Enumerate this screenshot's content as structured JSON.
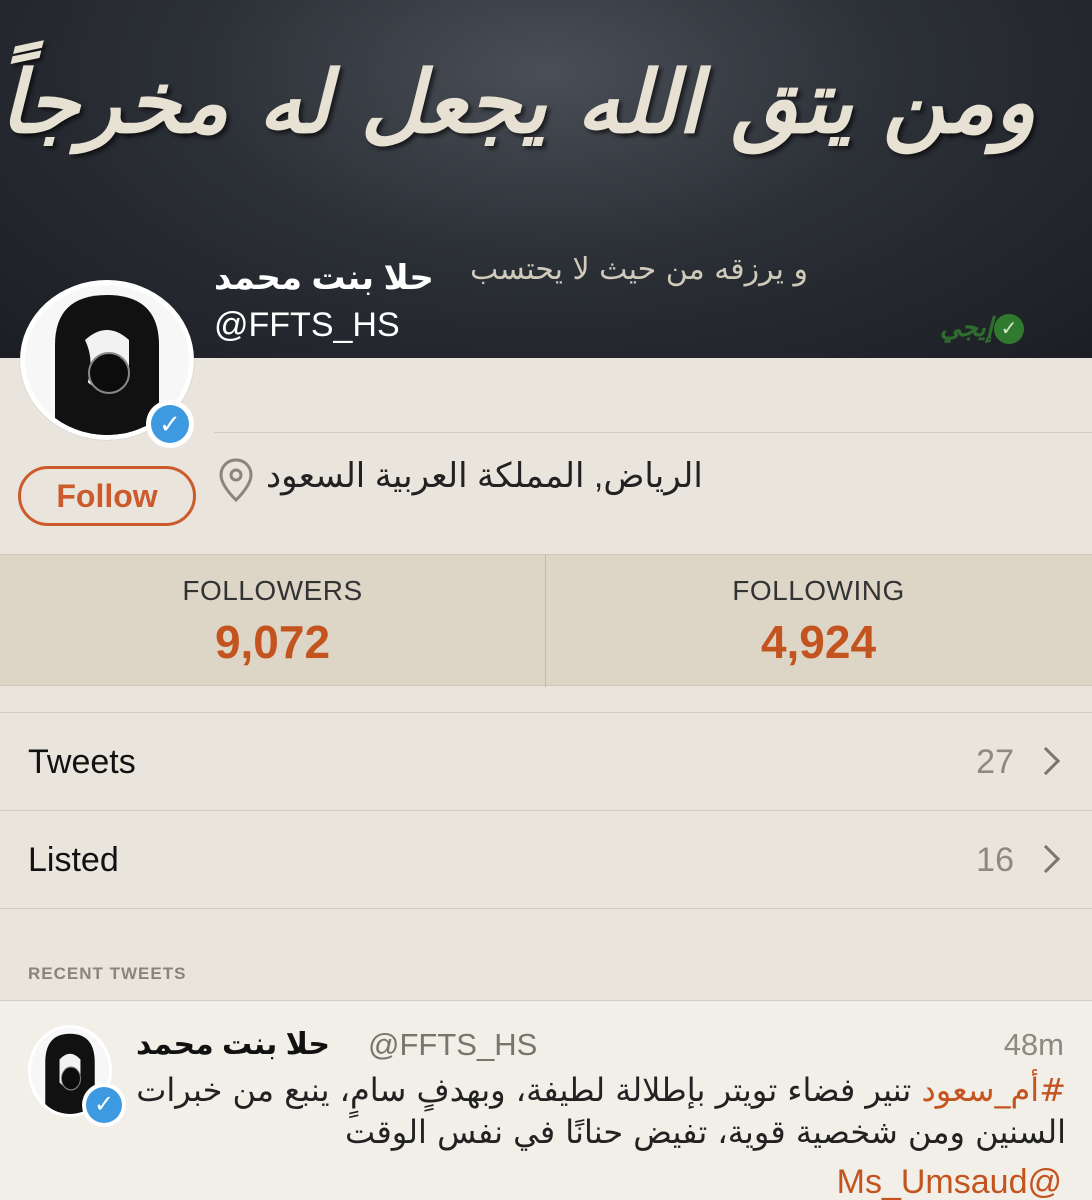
{
  "banner": {
    "line1": "ومن يتق الله يجعل له مخرجاً",
    "line2": "و يرزقه من حيث لا يحتسب",
    "logo_text": "إيجي"
  },
  "profile": {
    "name": "حلا بنت محمد",
    "handle": "@FFTS_HS",
    "location": "الرياض, المملكة العربية السعود",
    "follow_label": "Follow"
  },
  "stats": {
    "followers_label": "FOLLOWERS",
    "followers_value": "9,072",
    "following_label": "FOLLOWING",
    "following_value": "4,924"
  },
  "rows": [
    {
      "label": "Tweets",
      "count": "27"
    },
    {
      "label": "Listed",
      "count": "16"
    }
  ],
  "recent": {
    "header": "RECENT TWEETS",
    "tweet": {
      "name": "حلا بنت محمد",
      "handle": "@FFTS_HS",
      "time": "48m",
      "hashtag": "#أم_سعود",
      "text": " تنير فضاء تويتر بإطلالة لطيفة، وبهدفٍ سامٍ، ينبع من خبرات السنين ومن شخصية قوية، تفيض حنانًا في نفس الوقت",
      "mention": "Ms_Umsaud@"
    }
  },
  "colors": {
    "accent": "#c4541f",
    "verified": "#3d9ae0",
    "background": "#e9e5dc",
    "stats_bg": "#ddd6c6"
  }
}
